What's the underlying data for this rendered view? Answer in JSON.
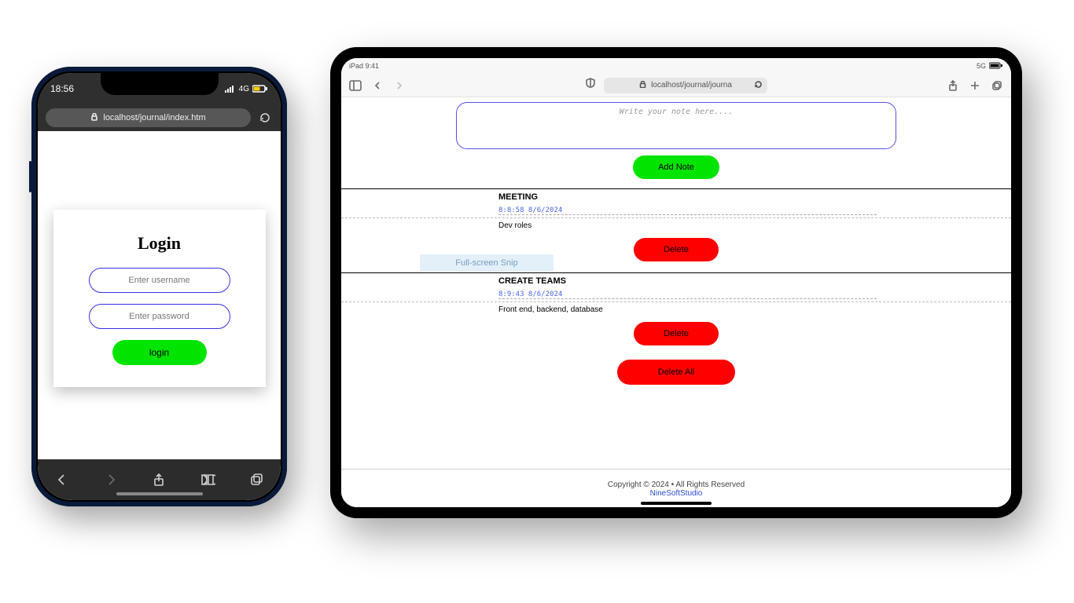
{
  "phone": {
    "status": {
      "time": "18:56",
      "net_label": "4G"
    },
    "address_url": "localhost/journal/index.htm",
    "login": {
      "heading": "Login",
      "username_placeholder": "Enter username",
      "password_placeholder": "Enter password",
      "button": "login"
    }
  },
  "tablet": {
    "status": {
      "device": "iPad 9:41",
      "net_label": "5G"
    },
    "address_url": "localhost/journal/journa",
    "editor": {
      "placeholder": "Write your note here....",
      "add_button": "Add Note"
    },
    "notes": [
      {
        "title": "MEETING",
        "timestamp": "8:8:58 8/6/2024",
        "body": "Dev roles",
        "delete_label": "Delete"
      },
      {
        "title": "CREATE TEAMS",
        "timestamp": "8:9:43 8/6/2024",
        "body": "Front end, backend, database",
        "delete_label": "Delete"
      }
    ],
    "delete_all": "Delete All",
    "footer": {
      "copyright": "Copyright © 2024 • All Rights Reserved",
      "studio": "NineSoftStudio"
    },
    "overlay": "Full-screen Snip"
  }
}
